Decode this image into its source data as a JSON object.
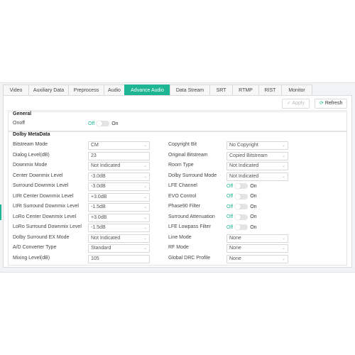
{
  "tabs": [
    {
      "label": "Video"
    },
    {
      "label": "Auxiliary Data"
    },
    {
      "label": "Preprocess"
    },
    {
      "label": "Audio"
    },
    {
      "label": "Advance Audio",
      "active": true
    },
    {
      "label": "Data Stream"
    },
    {
      "label": "SRT"
    },
    {
      "label": "RTMP"
    },
    {
      "label": "RIST"
    },
    {
      "label": "Monitor"
    }
  ],
  "toolbar": {
    "apply_label": "Apply",
    "apply_icon": "check-icon",
    "refresh_label": "Refresh",
    "refresh_icon": "refresh-icon"
  },
  "general": {
    "title": "General",
    "onoff_label": "Onoff",
    "onoff_off": "Off",
    "onoff_on": "On"
  },
  "dolby": {
    "title": "Dolby MetaData",
    "left": [
      {
        "label": "Bitstream Mode",
        "value": "CM",
        "kind": "select"
      },
      {
        "label": "Dialog Level(dB)",
        "value": "23",
        "kind": "input"
      },
      {
        "label": "Downmix Mode",
        "value": "Not Indicated",
        "kind": "select"
      },
      {
        "label": "Center Downmix Level",
        "value": "-3.0dB",
        "kind": "select"
      },
      {
        "label": "Surround Downmix Level",
        "value": "-3.0dB",
        "kind": "select"
      },
      {
        "label": "LtRt Center Downmix Level",
        "value": "+3.0dB",
        "kind": "select"
      },
      {
        "label": "LtRt Surround Downmix Level",
        "value": "-1.5dB",
        "kind": "select"
      },
      {
        "label": "LoRo Center Downmix Level",
        "value": "+3.0dB",
        "kind": "select"
      },
      {
        "label": "LoRo Surround Downmix Level",
        "value": "-1.5dB",
        "kind": "select"
      },
      {
        "label": "Dolby Surround EX Mode",
        "value": "Not Indicated",
        "kind": "select"
      },
      {
        "label": "A/D Converter Type",
        "value": "Standard",
        "kind": "select"
      },
      {
        "label": "Mixing Level(dB)",
        "value": "105",
        "kind": "input"
      }
    ],
    "right": [
      {
        "label": "Copyright Bit",
        "value": "No Copyright",
        "kind": "select"
      },
      {
        "label": "Original Bitstream",
        "value": "Copied Bitstream",
        "kind": "select"
      },
      {
        "label": "Room Type",
        "value": "Not Indicated",
        "kind": "select"
      },
      {
        "label": "Dolby Surround Mode",
        "value": "Not Indicated",
        "kind": "select"
      },
      {
        "label": "LFE Channel",
        "off": "Off",
        "on": "On",
        "kind": "toggle"
      },
      {
        "label": "EVO Control",
        "off": "Off",
        "on": "On",
        "kind": "toggle"
      },
      {
        "label": "Phase90 Filter",
        "off": "Off",
        "on": "On",
        "kind": "toggle"
      },
      {
        "label": "Surround Attenuation",
        "off": "Off",
        "on": "On",
        "kind": "toggle"
      },
      {
        "label": "LFE Lowpass Filter",
        "off": "Off",
        "on": "On",
        "kind": "toggle"
      },
      {
        "label": "Line Mode",
        "value": "None",
        "kind": "select"
      },
      {
        "label": "RF Mode",
        "value": "None",
        "kind": "select"
      },
      {
        "label": "Global DRC Profile",
        "value": "None",
        "kind": "select"
      }
    ]
  },
  "colors": {
    "accent": "#1db593"
  }
}
